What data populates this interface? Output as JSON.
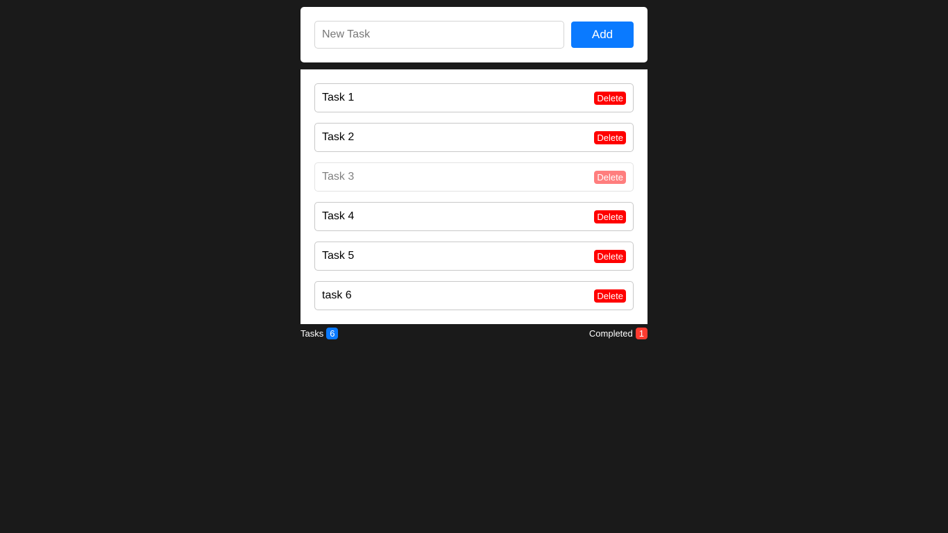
{
  "input": {
    "placeholder": "New Task",
    "value": ""
  },
  "add_label": "Add",
  "tasks": [
    {
      "label": "Task 1",
      "completed": false
    },
    {
      "label": "Task 2",
      "completed": false
    },
    {
      "label": "Task 3",
      "completed": true
    },
    {
      "label": "Task 4",
      "completed": false
    },
    {
      "label": "Task 5",
      "completed": false
    },
    {
      "label": "task 6",
      "completed": false
    }
  ],
  "delete_label": "Delete",
  "footer": {
    "tasks_label": "Tasks",
    "tasks_count": "6",
    "completed_label": "Completed",
    "completed_count": "1"
  },
  "colors": {
    "accent": "#0a7aff",
    "delete": "#ff0000",
    "completed_badge": "#ff3b30",
    "background": "#1a1a1a"
  }
}
